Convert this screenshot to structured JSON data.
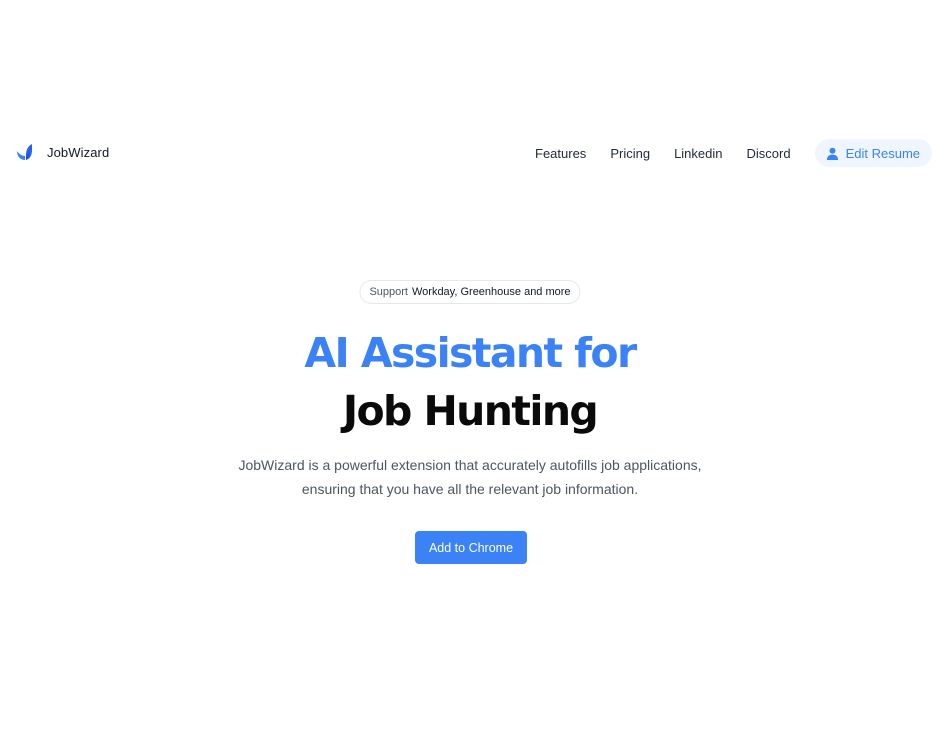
{
  "brand": {
    "name": "JobWizard",
    "logo_icon": "jobwizard-logo-icon",
    "colors": {
      "primary": "#3b82f6",
      "secondary": "#1d4ed8"
    }
  },
  "nav": {
    "links": [
      {
        "label": "Features"
      },
      {
        "label": "Pricing"
      },
      {
        "label": "Linkedin"
      },
      {
        "label": "Discord"
      }
    ],
    "edit_resume": {
      "label": "Edit Resume",
      "icon": "user-icon"
    }
  },
  "hero": {
    "support_prefix": "Support",
    "support_rest": "Workday, Greenhouse and more",
    "headline_line1": "AI Assistant for",
    "headline_line2": "Job Hunting",
    "description_line1": "JobWizard is a powerful extension that accurately autofills job applications,",
    "description_line2": "ensuring that you have all the relevant job information.",
    "cta_label": "Add to Chrome"
  },
  "colors": {
    "accent": "#3b82f6",
    "accent_light_bg": "#eff6ff",
    "text_dark": "#111827",
    "text_muted": "#4b5563",
    "border": "#e5e7eb"
  }
}
